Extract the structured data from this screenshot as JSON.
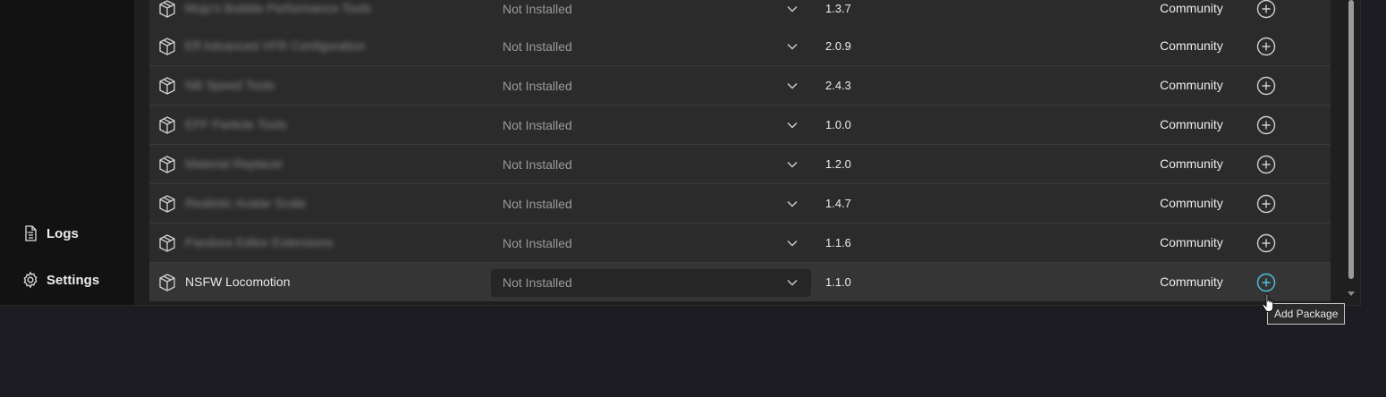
{
  "sidebar": {
    "items": [
      {
        "label": "Logs",
        "icon": "document-icon"
      },
      {
        "label": "Settings",
        "icon": "gear-icon"
      }
    ]
  },
  "packages": [
    {
      "name": "Mojo's Bubble Performance Tools",
      "status": "Not Installed",
      "version": "1.3.7",
      "source": "Community"
    },
    {
      "name": "Eff Advanced VFR Configuration",
      "status": "Not Installed",
      "version": "2.0.9",
      "source": "Community"
    },
    {
      "name": "NB Speed Tools",
      "status": "Not Installed",
      "version": "2.4.3",
      "source": "Community"
    },
    {
      "name": "EFF Particle Tools",
      "status": "Not Installed",
      "version": "1.0.0",
      "source": "Community"
    },
    {
      "name": "Material Replacer",
      "status": "Not Installed",
      "version": "1.2.0",
      "source": "Community"
    },
    {
      "name": "Realistic Avatar Scale",
      "status": "Not Installed",
      "version": "1.4.7",
      "source": "Community"
    },
    {
      "name": "Pandora Editor Extensions",
      "status": "Not Installed",
      "version": "1.1.6",
      "source": "Community"
    },
    {
      "name": "NSFW Locomotion",
      "status": "Not Installed",
      "version": "1.1.0",
      "source": "Community"
    }
  ],
  "tooltip": {
    "text": "Add Package"
  },
  "colors": {
    "accent": "#4fc3e0",
    "icon": "#cfcfcf"
  }
}
